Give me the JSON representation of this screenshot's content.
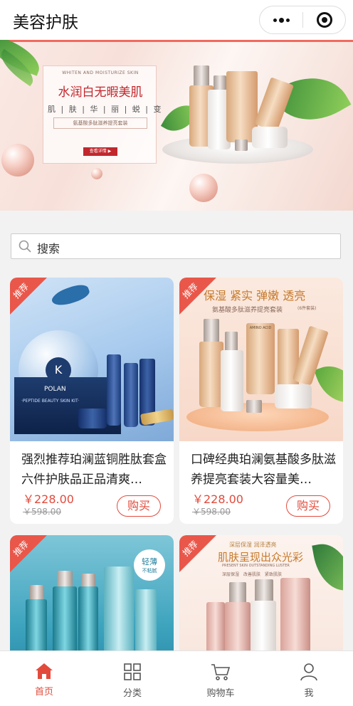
{
  "app": {
    "title": "美容护肤"
  },
  "banner": {
    "en_headline": "WHITEN AND MOISTURIZE SKIN",
    "headline": "水润白无暇美肌",
    "chars": "肌 | 肤 | 华 | 丽 | 蜕 | 变",
    "subline": "氨基酸多肽滋养提亮套装",
    "cta": "查看详情 ▶",
    "slide_count": 2,
    "active_slide": 2
  },
  "search": {
    "placeholder": "搜索"
  },
  "products": [
    {
      "badge": "推荐",
      "name": "强烈推荐珀澜蓝铜胜肽套盒六件护肤品正品清爽…",
      "price": "￥228.00",
      "original_price": "￥598.00",
      "buy_label": "购买",
      "image_text": {
        "brand": "POLAN",
        "kit": "·PEPTIDE BEAUTY SKIN KIT·"
      }
    },
    {
      "badge": "推荐",
      "name": "口碑经典珀澜氨基酸多肽滋养提亮套装大容量美…",
      "price": "￥228.00",
      "original_price": "￥598.00",
      "buy_label": "购买",
      "image_text": {
        "headline": "保湿 紧实 弹嫩 透亮",
        "subline": "氨基酸多肽滋养提亮套装",
        "tag": "(6件套装)",
        "bottle": "AMINO ACID"
      }
    },
    {
      "badge": "推荐",
      "image_text": {
        "tag": "轻薄",
        "tag_sub": "不粘腻"
      }
    },
    {
      "badge": "推荐",
      "image_text": {
        "top": "深层保湿 润泽透亮",
        "headline": "肌肤呈现出众光彩",
        "en": "PRESENT SKIN OUTSTANDING LUSTER",
        "features": [
          "深层保湿",
          "改善肌肤",
          "紧致肌肤"
        ]
      }
    }
  ],
  "tabbar": {
    "items": [
      {
        "label": "首页",
        "icon": "home-icon",
        "active": true
      },
      {
        "label": "分类",
        "icon": "grid-icon",
        "active": false
      },
      {
        "label": "购物车",
        "icon": "cart-icon",
        "active": false
      },
      {
        "label": "我",
        "icon": "user-icon",
        "active": false
      }
    ]
  },
  "colors": {
    "accent": "#e24b3c",
    "badge": "#e9574a"
  }
}
